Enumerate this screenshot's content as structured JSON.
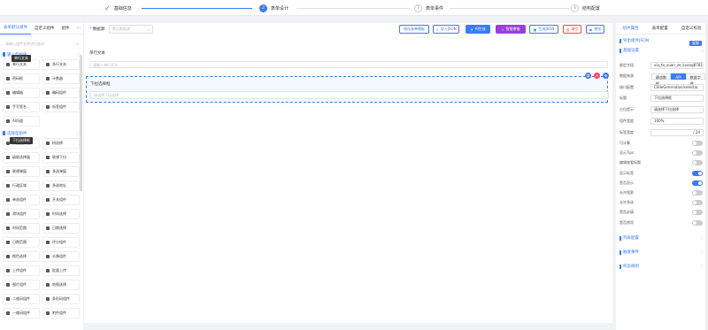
{
  "steps": [
    {
      "num": "✓",
      "label": "基础信息"
    },
    {
      "num": "2",
      "label": "表单设计"
    },
    {
      "num": "3",
      "label": "表单事件"
    },
    {
      "num": "4",
      "label": "结构配置"
    }
  ],
  "left": {
    "tabs": [
      "表单默认组件",
      "自定义组件",
      "组件",
      "···"
    ],
    "search_placeholder": "请输入组件名称进行查询",
    "tooltip_top": "单行文本",
    "tooltip_mid": "下拉选择框",
    "group1": "输入型组件",
    "group2": "选择型组件",
    "group1_items": [
      "单行文本",
      "多行文本",
      "密码框",
      "计数器",
      "编辑器",
      "编码组件",
      "手写签名",
      "标签组件",
      "AI问道"
    ],
    "group2_items": [
      "下拉选择框",
      "树选择",
      "级联选择器",
      "联想下拉",
      "联想弹窗",
      "多选弹窗",
      "行政区域",
      "多选地址",
      "单选组件",
      "开关组件",
      "滑块组件",
      "时间选择",
      "时间范围",
      "日期选择",
      "日期范围",
      "评分组件",
      "颜色选择",
      "头像组件",
      "上传组件",
      "批量上传",
      "图片组件",
      "地图选择",
      "二维码组件",
      "条形码组件",
      "一维码组件",
      "附件组件"
    ]
  },
  "toolbar": {
    "datasource_label": "数据源:",
    "datasource_placeholder": "默认数据源",
    "buttons": [
      "保存表单模板",
      "导入JSON",
      "AI生成",
      "智能审查",
      "生成JSON",
      "清空",
      "预览"
    ]
  },
  "canvas": {
    "field1_label": "单行文本",
    "field1_placeholder": "请输入单行文本",
    "field2_label": "下拉选择框",
    "field2_placeholder": "请选择下拉选择"
  },
  "right": {
    "tabs": [
      "组件属性",
      "表单配置",
      "自定义校验"
    ],
    "sec_basic": "基础设置",
    "sec_layout": "导出组件JSON",
    "copy_btn": "复制",
    "rows": [
      {
        "label": "绑定字段",
        "value": "via_ta_xuan_ze_kuang8781"
      },
      {
        "label": "数据来源",
        "value": ""
      },
      {
        "label": "接口配置",
        "value": "CodeGeneration/selectio"
      },
      {
        "label": "标题",
        "value": "下拉选择框"
      },
      {
        "label": "占位提示",
        "value": "请选择下拉选择"
      },
      {
        "label": "组件宽度",
        "value": "100%"
      },
      {
        "label": "标签宽度",
        "value": "/ 24"
      }
    ],
    "seg": [
      "静态数据",
      "API",
      "数据字典"
    ],
    "switches": [
      {
        "label": "可计算",
        "on": false
      },
      {
        "label": "显示Tips",
        "on": false
      },
      {
        "label": "编辑查看标题",
        "on": false
      },
      {
        "label": "显示标签",
        "on": true
      },
      {
        "label": "是否显示",
        "on": true
      },
      {
        "label": "允许搜索",
        "on": false
      },
      {
        "label": "允许多选",
        "on": false
      },
      {
        "label": "是否必填",
        "on": false
      },
      {
        "label": "是否禁用",
        "on": false
      }
    ],
    "sec_list": "列表配置",
    "sec_event": "触发事件",
    "sec_valid": "校验规则"
  }
}
